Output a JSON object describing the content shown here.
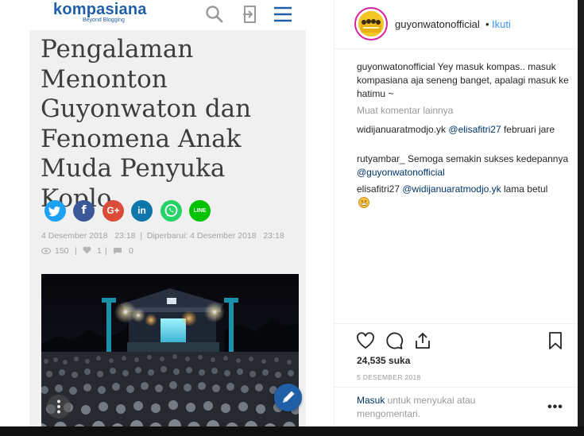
{
  "kompasiana": {
    "logo": "kompasiana",
    "tagline": "Beyond Blogging",
    "article_title": "Pengalaman Menonton Guyonwaton dan Fenomena Anak Muda Penyuka Koplo",
    "share_icons": [
      "twitter-icon",
      "facebook-icon",
      "google-plus-icon",
      "linkedin-icon",
      "whatsapp-icon",
      "line-icon"
    ],
    "share_labels": {
      "facebook": "f",
      "google_plus": "G+",
      "linkedin": "in",
      "line": "LINE"
    },
    "meta": "4 Desember 2018   23:18  |  Diperbarui: 4 Desember 2018   23:18",
    "stats": {
      "views": "150",
      "likes": "1",
      "comments": "0",
      "sep": "|"
    }
  },
  "instagram": {
    "username": "guyonwatonofficial",
    "dot": "•",
    "follow_label": "Ikuti",
    "caption": {
      "user": "guyonwatonofficial",
      "text": " Yey masuk kompas.. masuk kompasiana aja seneng banget, apalagi masuk ke hatimu ~"
    },
    "load_more": "Muat komentar lainnya",
    "comments": [
      {
        "user": "widijanuaratmodjo.yk",
        "mention": "@elisafitri27",
        "text": " februari jare"
      },
      {
        "user": "rutyambar_",
        "text": " Semoga semakin sukses kedepannya ",
        "mention": "@guyonwatonofficial"
      },
      {
        "user": "elisafitri27",
        "mention": "@widijanuaratmodjo.yk",
        "text": " lama betul"
      }
    ],
    "likes": "24,535 suka",
    "date": "5 DESEMBER 2018",
    "login_link": "Masuk",
    "login_text": " untuk menyukai atau mengomentari.",
    "more_label": "•••"
  },
  "colors": {
    "kompas_blue": "#1f5fa7",
    "ig_link": "#3897f0",
    "ig_mention": "#003569",
    "ig_text": "#262626",
    "ig_muted": "#999999"
  }
}
